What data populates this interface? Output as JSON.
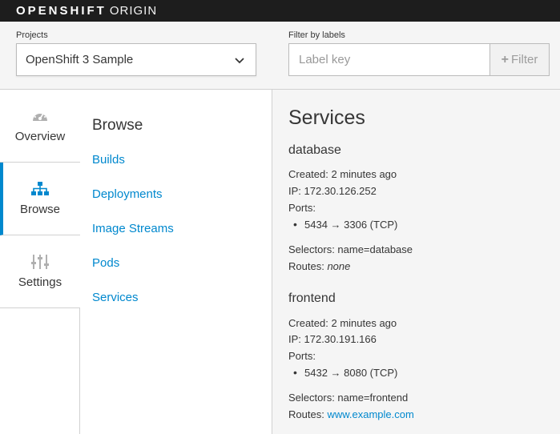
{
  "brand": {
    "part1": "OPENSHIFT",
    "part2": "ORIGIN"
  },
  "toolbar": {
    "projects_label": "Projects",
    "project_selected": "OpenShift 3 Sample",
    "filter_label": "Filter by labels",
    "filter_placeholder": "Label key",
    "filter_button": "Filter"
  },
  "leftnav": {
    "items": [
      {
        "label": "Overview",
        "icon": "dashboard-icon"
      },
      {
        "label": "Browse",
        "icon": "sitemap-icon",
        "active": true
      },
      {
        "label": "Settings",
        "icon": "sliders-icon"
      }
    ]
  },
  "secnav": {
    "title": "Browse",
    "links": [
      "Builds",
      "Deployments",
      "Image Streams",
      "Pods",
      "Services"
    ]
  },
  "main": {
    "title": "Services",
    "services": [
      {
        "name": "database",
        "created": "Created: 2 minutes ago",
        "ip": "IP: 172.30.126.252",
        "ports_label": "Ports:",
        "port": "5434 → 3306 (TCP)",
        "selectors": "Selectors: name=database",
        "routes_label": "Routes:",
        "routes_value": "none"
      },
      {
        "name": "frontend",
        "created": "Created: 2 minutes ago",
        "ip": "IP: 172.30.191.166",
        "ports_label": "Ports:",
        "port": "5432 → 8080 (TCP)",
        "selectors": "Selectors: name=frontend",
        "routes_label": "Routes:",
        "routes_value": "www.example.com"
      }
    ]
  },
  "colors": {
    "accent": "#0088ce",
    "brandbar": "#1d1d1d",
    "panel": "#f5f5f5"
  }
}
